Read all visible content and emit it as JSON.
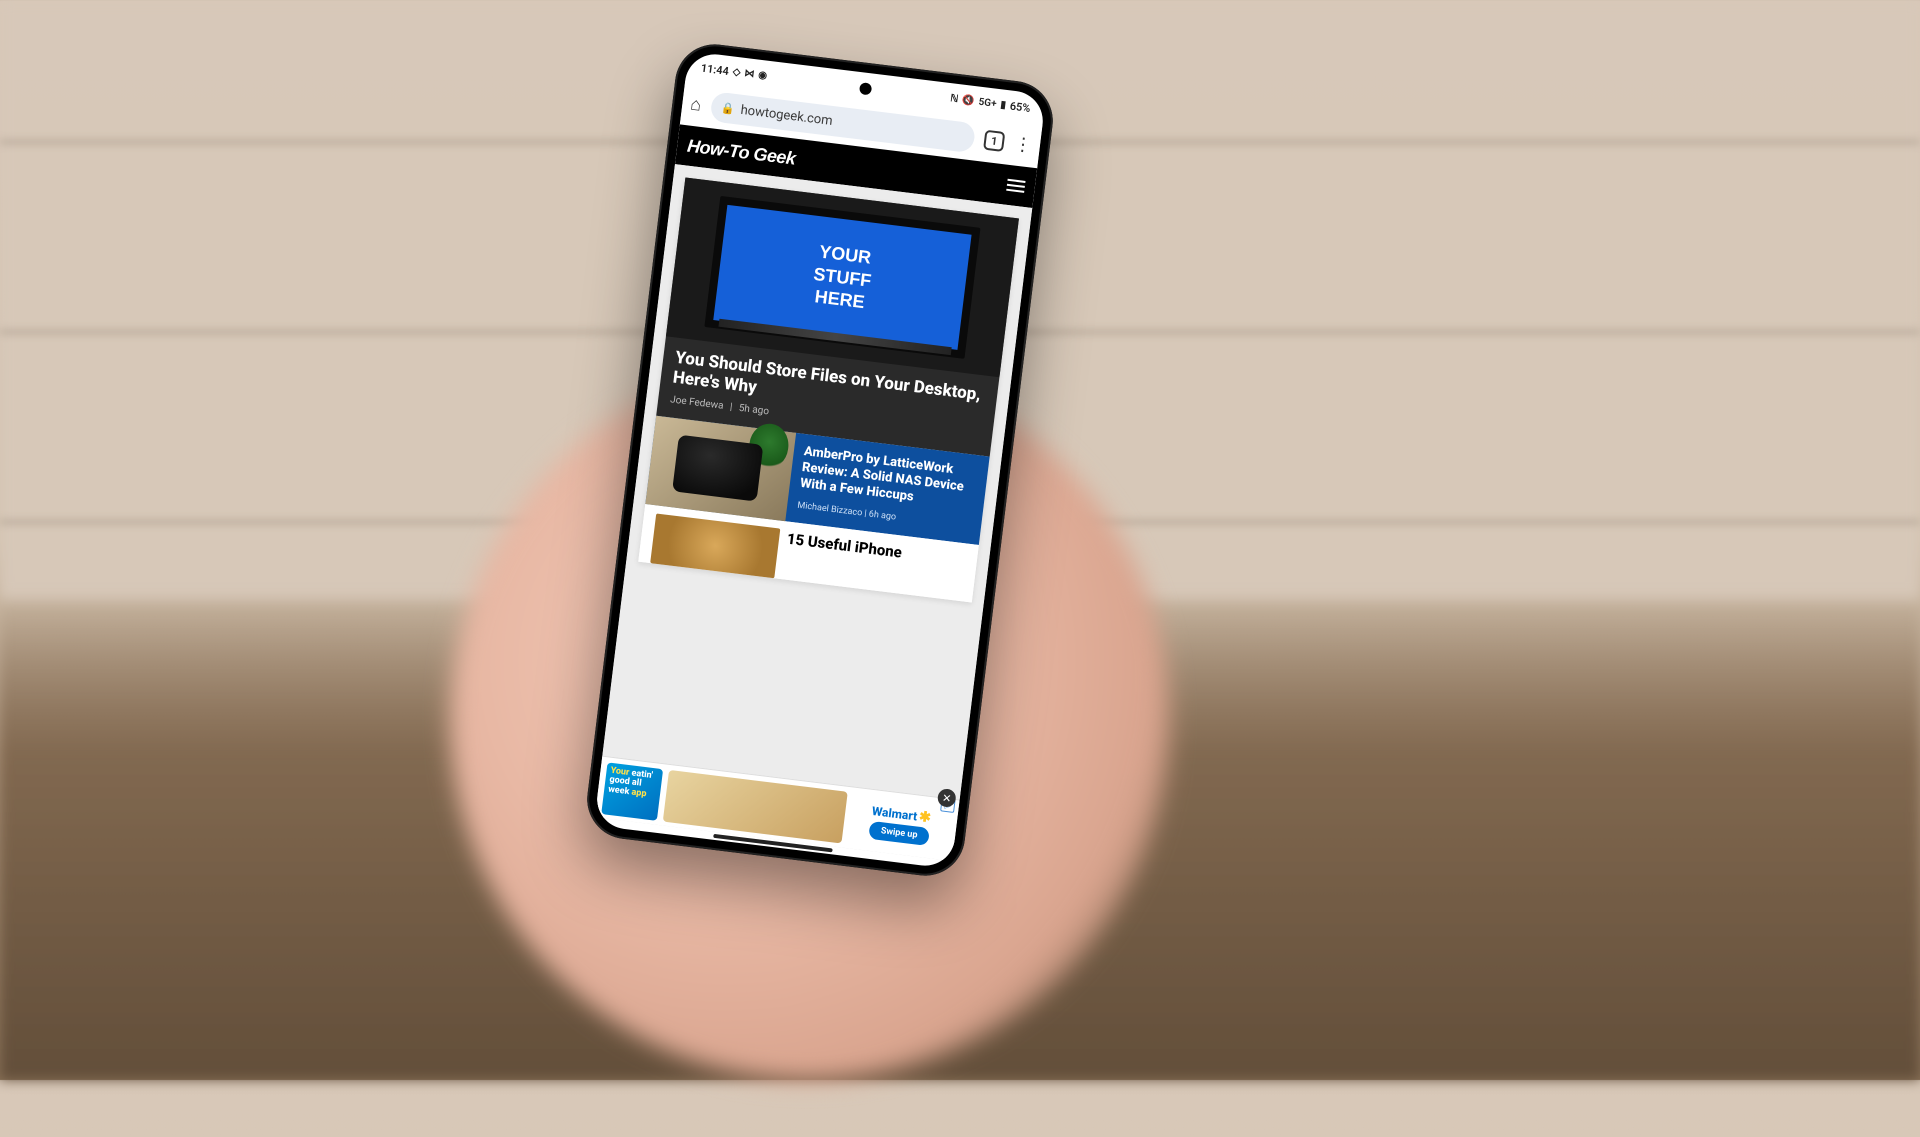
{
  "status": {
    "time": "11:44",
    "network_label": "5G+",
    "battery": "65%"
  },
  "browser": {
    "url": "howtogeek.com",
    "tab_count": "1"
  },
  "site": {
    "logo": "How-To Geek"
  },
  "articles": {
    "hero": {
      "monitor_line1": "YOUR",
      "monitor_line2": "STUFF",
      "monitor_line3": "HERE",
      "title": "You Should Store Files on Your Desktop, Here's Why",
      "author": "Joe Fedewa",
      "age": "5h ago"
    },
    "second": {
      "title": "AmberPro by LatticeWork Review: A Solid NAS Device With a Few Hiccups",
      "author": "Michael Bizzaco",
      "age": "6h ago"
    },
    "third": {
      "title": "15 Useful iPhone"
    }
  },
  "ad": {
    "line1": "Your",
    "line2": "eatin' good all week",
    "line3": "app",
    "brand": "Walmart",
    "cta": "Swipe up",
    "close": "✕",
    "tag": "▷"
  }
}
